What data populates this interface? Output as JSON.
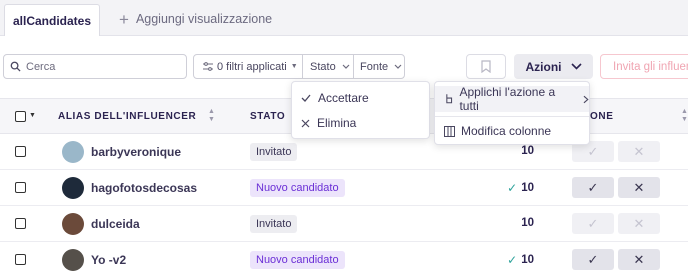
{
  "tabs": {
    "active": "allCandidates",
    "add_label": "Aggiungi visualizzazione"
  },
  "toolbar": {
    "search_placeholder": "Cerca",
    "filters_label": "0 filtri applicati",
    "stato_label": "Stato",
    "fonte_label": "Fonte",
    "azioni_label": "Azioni",
    "invite_label": "Invita gli influencer"
  },
  "table": {
    "headers": {
      "alias": "ALIAS DELL'INFLUENCER",
      "stato": "STATO",
      "actions": "ONE"
    },
    "rows": [
      {
        "alias": "barbyveronique",
        "status": "Invitato",
        "status_type": "invitato",
        "score": "10",
        "score_tick": false,
        "actions_enabled": false,
        "avatar_color": "#9ab7c9"
      },
      {
        "alias": "hagofotosdecosas",
        "status": "Nuovo candidato",
        "status_type": "nuovo",
        "score": "10",
        "score_tick": true,
        "actions_enabled": true,
        "avatar_color": "#1e2a3a"
      },
      {
        "alias": "dulceida",
        "status": "Invitato",
        "status_type": "invitato",
        "score": "10",
        "score_tick": false,
        "actions_enabled": false,
        "avatar_color": "#6b4a3a"
      },
      {
        "alias": "Yo -v2",
        "status": "Nuovo candidato",
        "status_type": "nuovo",
        "score": "10",
        "score_tick": true,
        "actions_enabled": true,
        "avatar_color": "#55504a"
      }
    ]
  },
  "stato_dropdown": {
    "items": [
      "Accettare",
      "Elimina"
    ]
  },
  "azioni_dropdown": {
    "apply_all": "Applichi l'azione a tutti",
    "modify_columns": "Modifica colonne"
  },
  "colors": {
    "accent_purple": "#6b2fd6",
    "tick_teal": "#2ea39b",
    "invite_pink": "#f0a5b2"
  }
}
